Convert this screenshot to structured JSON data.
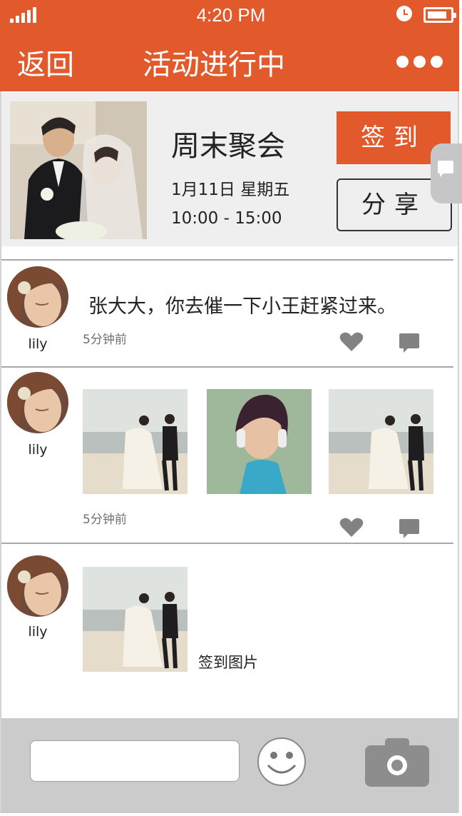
{
  "status_bar": {
    "time": "4:20 PM",
    "battery_level": 0.85
  },
  "header": {
    "back_label": "返回",
    "title": "活动进行中",
    "more_icon": "more-dots-icon"
  },
  "event": {
    "name": "周末聚会",
    "date": "1月11日 星期五",
    "time_range": "10:00 - 15:00",
    "checkin_label": "签到",
    "share_label": "分享"
  },
  "posts": [
    {
      "user": "lily",
      "message": "张大大，你去催一下小王赶紧过来。",
      "ago": "5分钟前"
    },
    {
      "user": "lily",
      "ago": "5分钟前"
    },
    {
      "user": "lily",
      "caption": "签到图片"
    }
  ],
  "colors": {
    "accent": "#e2592c",
    "panel": "#efefef",
    "bottom_bar": "#cbcbcb",
    "icon_gray": "#828282"
  }
}
